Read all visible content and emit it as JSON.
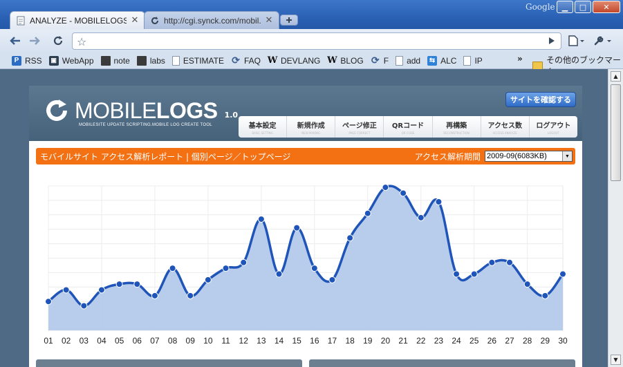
{
  "browser": {
    "brand": "Google",
    "tabs": [
      {
        "label": "ANALYZE - MOBILELOGS",
        "active": true,
        "icon": "page-icon"
      },
      {
        "label": "http://cgi.synck.com/mobil...",
        "active": false,
        "icon": "reload-icon"
      }
    ],
    "omnibox_value": "",
    "bookmarks": [
      {
        "label": "RSS",
        "icon": "rss"
      },
      {
        "label": "WebApp",
        "icon": "webapp"
      },
      {
        "label": "note",
        "icon": "note"
      },
      {
        "label": "labs",
        "icon": "note"
      },
      {
        "label": "ESTIMATE",
        "icon": "page"
      },
      {
        "label": "FAQ",
        "icon": "reload"
      },
      {
        "label": "DEVLANG",
        "icon": "w"
      },
      {
        "label": "BLOG",
        "icon": "w"
      },
      {
        "label": "F",
        "icon": "reload"
      },
      {
        "label": "add",
        "icon": "page"
      },
      {
        "label": "ALC",
        "icon": "alc"
      },
      {
        "label": "IP",
        "icon": "page"
      }
    ],
    "bookmarks_more": "»",
    "other_bookmarks": "その他のブックマーク"
  },
  "site": {
    "logo_light": "MOBILE",
    "logo_bold": "LOGS",
    "version": "1.0",
    "tagline": "MOBILESITE UPDATE SCRIPTING.MOBILE LOG CREATE TOOL",
    "visit_button": "サイトを確認する",
    "nav": [
      {
        "label": "基本設定",
        "sub": "BASIC SETTING"
      },
      {
        "label": "新規作成",
        "sub": "NEW MAKING"
      },
      {
        "label": "ページ修正",
        "sub": "PAGE CORRECT"
      },
      {
        "label": "QRコード",
        "sub": "QR CODE"
      },
      {
        "label": "再構築",
        "sub": "RECONSTRUCTION"
      },
      {
        "label": "アクセス数",
        "sub": "ACCESS ANALYZE"
      },
      {
        "label": "ログアウト",
        "sub": "LOGOUT"
      }
    ],
    "report_title": "モバイルサイト アクセス解析レポート | 個別ページ／トップページ",
    "period_label": "アクセス解析期間",
    "period_value": "2009-09(6083KB)"
  },
  "colors": {
    "accent_orange": "#f37013",
    "line_blue": "#1f54b8",
    "fill_blue": "#b4c9ea"
  },
  "chart_data": {
    "type": "area",
    "categories": [
      "01",
      "02",
      "03",
      "04",
      "05",
      "06",
      "07",
      "08",
      "09",
      "10",
      "11",
      "12",
      "13",
      "14",
      "15",
      "16",
      "17",
      "18",
      "19",
      "20",
      "21",
      "22",
      "23",
      "24",
      "25",
      "26",
      "27",
      "28",
      "29",
      "30"
    ],
    "series": [
      {
        "values": [
          20,
          28,
          17,
          28,
          32,
          32,
          24,
          43,
          24,
          35,
          43,
          47,
          77,
          39,
          71,
          43,
          35,
          64,
          81,
          99,
          95,
          78,
          89,
          39,
          39,
          47,
          47,
          32,
          24,
          39
        ]
      }
    ],
    "ylim": [
      0,
      100
    ],
    "grid": true
  }
}
